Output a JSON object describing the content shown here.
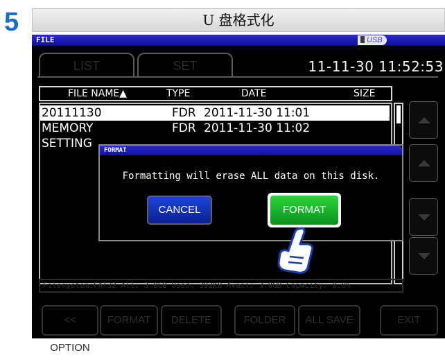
{
  "step": "5",
  "caption": "U 盘格式化",
  "window": {
    "title": "FILE",
    "drive_badge": "USB"
  },
  "tabs": [
    {
      "label": "LIST"
    },
    {
      "label": "SET"
    }
  ],
  "clock": "11-11-30 11:52:53",
  "columns": {
    "name": "FILE NAME▲",
    "type": "TYPE",
    "date": "DATE",
    "size": "SIZE"
  },
  "files": [
    {
      "name": "20111130",
      "type": "FDR",
      "date": "2011-11-30  11:01",
      "selected": true
    },
    {
      "name": "MEMORY",
      "type": "FDR",
      "date": "2011-11-30  11:02",
      "selected": false
    },
    {
      "name": "SETTING",
      "type": "",
      "date": "",
      "selected": false
    }
  ],
  "info_bar": "Filesystem:FAT32 All: 3.8GB Used: 392KB Avail: 3.8GB Capacity: 0.0%",
  "function_buttons": [
    {
      "label": "<< OPTION"
    },
    {
      "label": "FORMAT"
    },
    {
      "label": "DELETE"
    },
    {
      "label": "FOLDER"
    },
    {
      "label": "ALL SAVE"
    },
    {
      "label": "EXIT"
    }
  ],
  "side_buttons": [
    "page-up",
    "up",
    "down",
    "page-down"
  ],
  "dialog": {
    "title": "FORMAT",
    "message": "Formatting will erase ALL data on this disk.",
    "cancel_label": "CANCEL",
    "format_label": "FORMAT"
  },
  "colors": {
    "title_bar": "#1a1ab8",
    "cancel_button": "#1336c4",
    "format_button": "#17b02a",
    "step_number": "#1a6fc4"
  }
}
